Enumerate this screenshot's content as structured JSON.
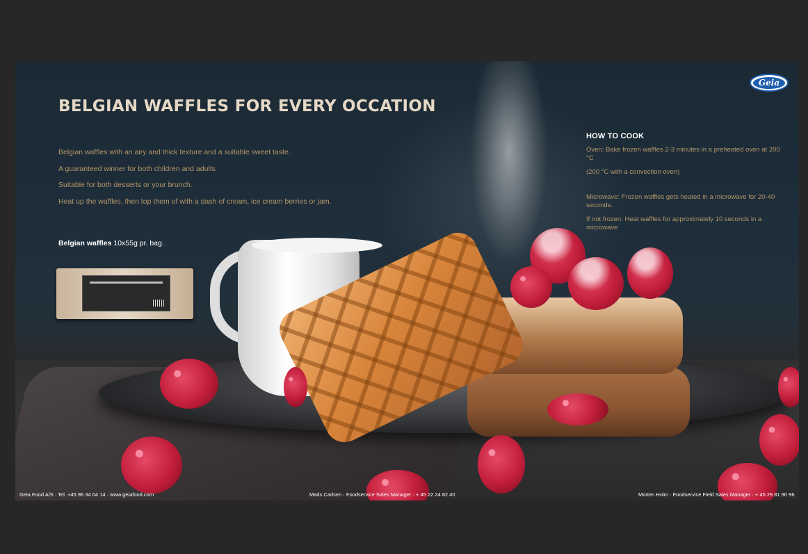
{
  "brand": {
    "logo_text": "Geia"
  },
  "title": "BELGIAN WAFFLES FOR EVERY OCCATION",
  "features": [
    "Belgian waffles with an airy and thick texture and a suitable sweet taste.",
    "A guaranteed winner for both children and adults",
    "Suitable for both desserts or your brunch.",
    "Heat up the waffles, then top them of with a dash of cream, ice cream berries or jam."
  ],
  "product": {
    "name": "Belgian waffles",
    "spec": "10x55g pr. bag."
  },
  "how_to_cook": {
    "heading": "HOW TO COOK",
    "oven": "Oven:  Bake frozen waffles 2-3 minutes in a preheated oven at 200 °C",
    "oven_note": "(200 °C with a convection oven)",
    "microwave": "Microwave: Frozen waffles gets heated in a microwave for 20-40 seconds.",
    "not_frozen": "If not frozen:  Heat waffles for approximately 10 seconds in a microwave"
  },
  "footer": {
    "company": "Geia Food A/S  ·  Tel. +45 96 34 04 14  ·  www.geiafood.com",
    "contact1": "Mads Carlsen  ·  Foodservice Sales Manager  ·  + 45 22 24 82 40",
    "contact2": "Morten Holm  ·  Foodservice Field Sales Manager  ·  + 45 29 81 90 96"
  },
  "colors": {
    "title": "#e6d8c6",
    "body_text": "#b6976b",
    "logo_blue": "#1f5fae",
    "viewer_bg": "#272727"
  }
}
